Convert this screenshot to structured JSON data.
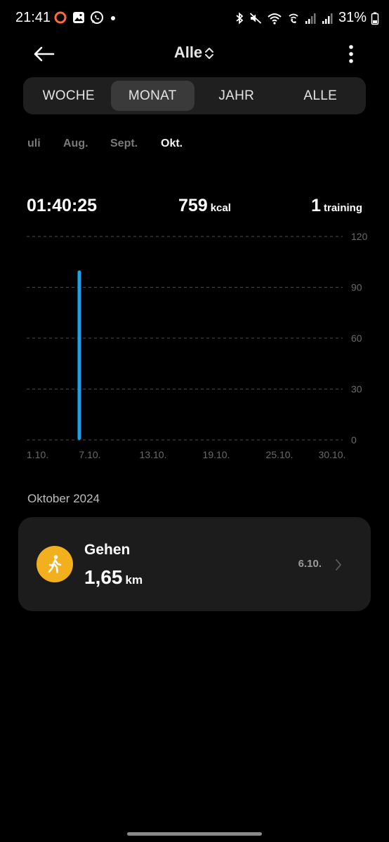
{
  "status_bar": {
    "time": "21:41",
    "battery": "31%",
    "left_icons": [
      "record-icon",
      "gallery-icon",
      "whatsapp-icon",
      "dot-icon"
    ],
    "right_icons": [
      "bluetooth-icon",
      "mute-icon",
      "wifi-icon",
      "wifi-call-icon",
      "signal-icon",
      "signal-icon",
      "battery-icon"
    ]
  },
  "header": {
    "title": "Alle",
    "back_icon": "arrow-left-icon",
    "title_icon": "sort-chevron-icon",
    "more_icon": "more-vertical-icon"
  },
  "segments": [
    {
      "label": "WOCHE",
      "active": false
    },
    {
      "label": "MONAT",
      "active": true
    },
    {
      "label": "JAHR",
      "active": false
    },
    {
      "label": "ALLE",
      "active": false
    }
  ],
  "months": [
    {
      "label": "uli",
      "active": false
    },
    {
      "label": "Aug.",
      "active": false
    },
    {
      "label": "Sept.",
      "active": false
    },
    {
      "label": "Okt.",
      "active": true
    }
  ],
  "summary": {
    "duration": "01:40:25",
    "calories_value": "759",
    "calories_unit": "kcal",
    "trainings_value": "1",
    "trainings_unit": "training"
  },
  "chart_data": {
    "type": "bar",
    "x": [
      "1.10.",
      "2.10.",
      "3.10.",
      "4.10.",
      "5.10.",
      "6.10.",
      "7.10.",
      "8.10.",
      "9.10.",
      "10.10.",
      "11.10.",
      "12.10.",
      "13.10.",
      "14.10.",
      "15.10.",
      "16.10.",
      "17.10.",
      "18.10.",
      "19.10.",
      "20.10.",
      "21.10.",
      "22.10.",
      "23.10.",
      "24.10.",
      "25.10.",
      "26.10.",
      "27.10.",
      "28.10.",
      "29.10.",
      "30.10.",
      "31.10."
    ],
    "values": [
      0,
      0,
      0,
      0,
      0,
      100,
      0,
      0,
      0,
      0,
      0,
      0,
      0,
      0,
      0,
      0,
      0,
      0,
      0,
      0,
      0,
      0,
      0,
      0,
      0,
      0,
      0,
      0,
      0,
      0,
      0
    ],
    "x_tick_labels": [
      "1.10.",
      "7.10.",
      "13.10.",
      "19.10.",
      "25.10.",
      "30.10."
    ],
    "y_ticks": [
      0,
      30,
      60,
      90,
      120
    ],
    "ylim": [
      0,
      120
    ],
    "grid": true,
    "bar_color": "#1aa3e8"
  },
  "list": {
    "section_label": "Oktober 2024",
    "items": [
      {
        "title": "Gehen",
        "value": "1,65",
        "unit": "km",
        "date": "6.10.",
        "icon": "walking-icon",
        "icon_color": "#f2b01e"
      }
    ]
  }
}
